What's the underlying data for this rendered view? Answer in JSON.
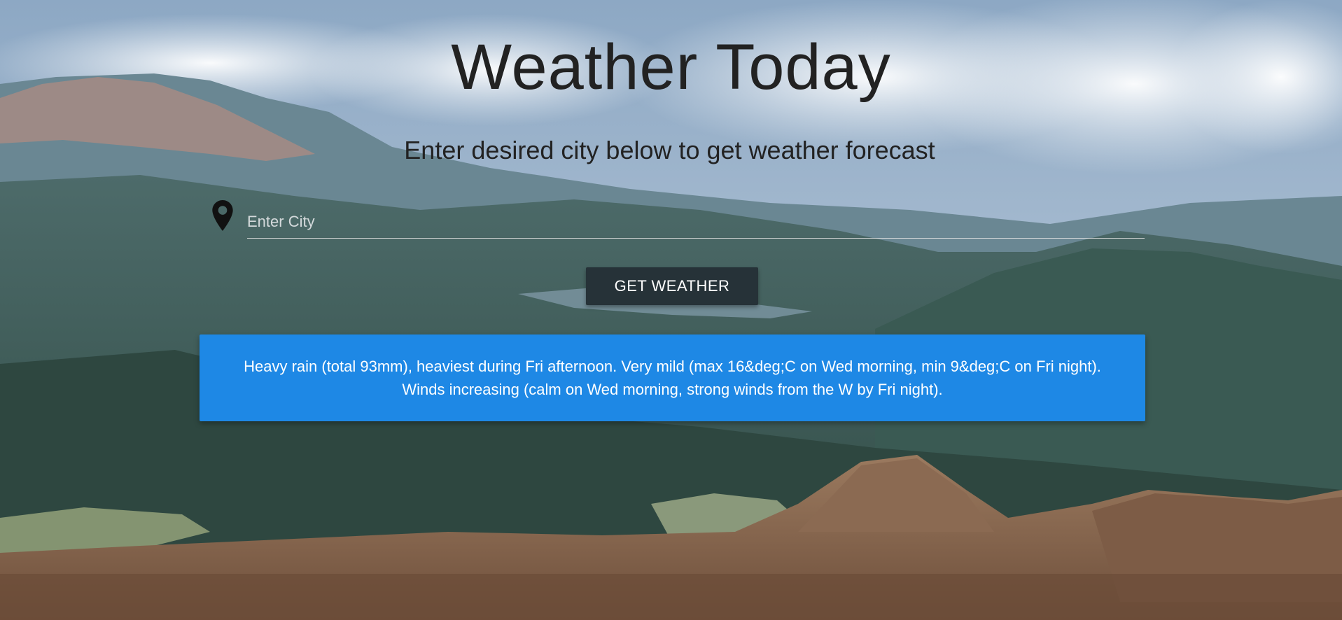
{
  "header": {
    "title": "Weather Today",
    "subtitle": "Enter desired city below to get weather forecast"
  },
  "search": {
    "placeholder": "Enter City",
    "value": "",
    "icon": "map-marker-icon"
  },
  "button": {
    "label": "GET WEATHER"
  },
  "forecast": {
    "line1": "Heavy rain (total 93mm), heaviest during Fri afternoon. Very mild (max 16&deg;C on Wed morning, min 9&deg;C on Fri night).",
    "line2": "Winds increasing (calm on Wed morning, strong winds from the W by Fri night)."
  },
  "colors": {
    "accent": "#1e88e5",
    "button": "#263238",
    "text_dark": "#222222"
  }
}
